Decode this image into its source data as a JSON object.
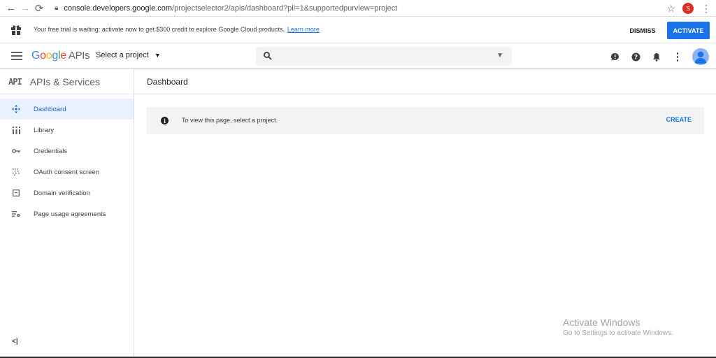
{
  "browser": {
    "url_host": "console.developers.google.com",
    "url_path": "/projectselector2/apis/dashboard?pli=1&supportedpurview=project",
    "profile_initial": "S"
  },
  "trial": {
    "message": "Your free trial is waiting: activate now to get $300 credit to explore Google Cloud products.",
    "link": "Learn more",
    "dismiss_label": "DISMISS",
    "activate_label": "ACTIVATE"
  },
  "topbar": {
    "logo_google": "Google",
    "logo_apis": "APIs",
    "project_label": "Select a project",
    "search_placeholder": ""
  },
  "sidebar": {
    "badge": "API",
    "title": "APIs & Services",
    "items": [
      {
        "label": "Dashboard",
        "icon": "dashboard-icon",
        "active": true
      },
      {
        "label": "Library",
        "icon": "library-icon",
        "active": false
      },
      {
        "label": "Credentials",
        "icon": "key-icon",
        "active": false
      },
      {
        "label": "OAuth consent screen",
        "icon": "consent-icon",
        "active": false
      },
      {
        "label": "Domain verification",
        "icon": "domain-icon",
        "active": false
      },
      {
        "label": "Page usage agreements",
        "icon": "settings-list-icon",
        "active": false
      }
    ],
    "collapse_label": "<|"
  },
  "main": {
    "title": "Dashboard",
    "notice_text": "To view this page, select a project.",
    "create_label": "CREATE"
  },
  "watermark": {
    "title": "Activate Windows",
    "subtitle": "Go to Settings to activate Windows."
  },
  "colors": {
    "accent": "#1a73e8",
    "active_bg": "#e8f0fe",
    "notice_bg": "#f1f3f4"
  }
}
